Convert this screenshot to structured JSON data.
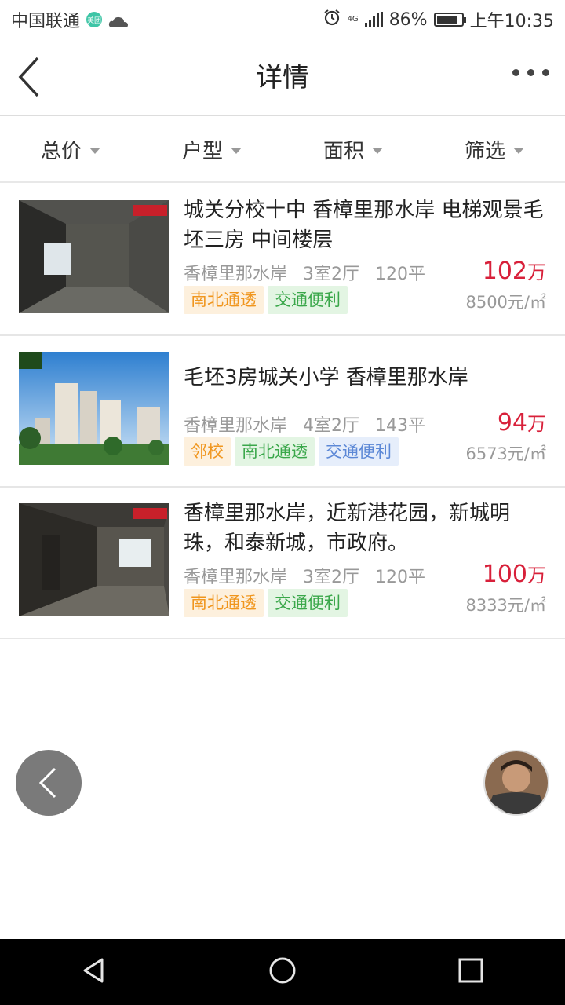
{
  "status_bar": {
    "carrier": "中国联通",
    "app_badge": "美团",
    "battery": "86%",
    "network": "4G",
    "time": "上午10:35"
  },
  "nav": {
    "title": "详情"
  },
  "filters": [
    {
      "label": "总价"
    },
    {
      "label": "户型"
    },
    {
      "label": "面积"
    },
    {
      "label": "筛选"
    }
  ],
  "listings": [
    {
      "title": "城关分校十中 香樟里那水岸 电梯观景毛坯三房 中间楼层",
      "community": "香樟里那水岸",
      "layout": "3室2厅",
      "area": "120平",
      "tags": [
        {
          "text": "南北通透",
          "color": "orange"
        },
        {
          "text": "交通便利",
          "color": "green"
        }
      ],
      "price_num": "102",
      "price_unit": "万",
      "unit_price": "8500元/㎡",
      "thumb": "interior"
    },
    {
      "title": "毛坯3房城关小学 香樟里那水岸",
      "community": "香樟里那水岸",
      "layout": "4室2厅",
      "area": "143平",
      "tags": [
        {
          "text": "邻校",
          "color": "orange"
        },
        {
          "text": "南北通透",
          "color": "green"
        },
        {
          "text": "交通便利",
          "color": "blue"
        }
      ],
      "price_num": "94",
      "price_unit": "万",
      "unit_price": "6573元/㎡",
      "thumb": "exterior"
    },
    {
      "title": "香樟里那水岸，近新港花园，新城明珠，和泰新城，市政府。",
      "community": "香樟里那水岸",
      "layout": "3室2厅",
      "area": "120平",
      "tags": [
        {
          "text": "南北通透",
          "color": "orange"
        },
        {
          "text": "交通便利",
          "color": "green"
        }
      ],
      "price_num": "100",
      "price_unit": "万",
      "unit_price": "8333元/㎡",
      "thumb": "interior"
    }
  ],
  "colors": {
    "price": "#d8203a",
    "tag_orange": "#f0961e",
    "tag_green": "#3aa74a",
    "tag_blue": "#5c88d6"
  }
}
